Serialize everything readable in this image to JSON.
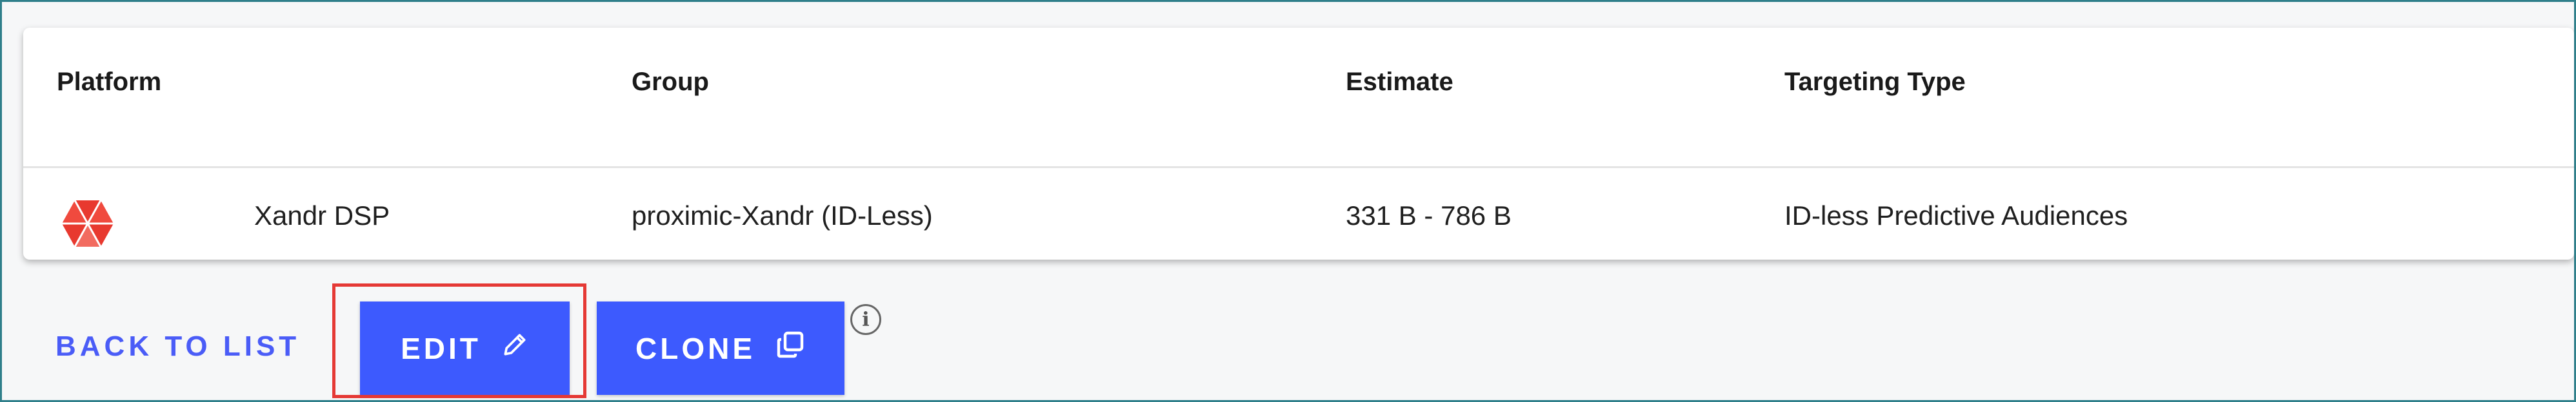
{
  "table": {
    "headers": [
      "Platform",
      "Group",
      "Estimate",
      "Targeting Type"
    ],
    "rows": [
      {
        "platform_icon": "xandr-logo",
        "platform": "Xandr DSP",
        "group": "proximic-Xandr (ID-Less)",
        "estimate": "331 B - 786 B",
        "targeting_type": "ID-less Predictive Audiences"
      }
    ]
  },
  "actions": {
    "back_label": "BACK TO LIST",
    "edit_label": "EDIT",
    "edit_icon": "pencil-icon",
    "clone_label": "CLONE",
    "clone_icon": "copy-icon",
    "info_icon": "info-icon"
  },
  "colors": {
    "accent": "#3d5afe",
    "link": "#4a5cf7",
    "highlight": "#e53935",
    "frame": "#2f7f8a",
    "logo_red": "#e8392f"
  }
}
